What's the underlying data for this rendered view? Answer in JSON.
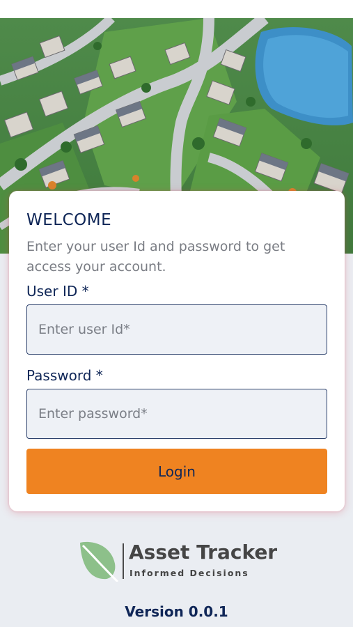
{
  "login_card": {
    "title": "WELCOME",
    "subtitle": "Enter your user Id and password to get access your account.",
    "user_id": {
      "label": "User ID *",
      "placeholder": "Enter user Id*",
      "value": ""
    },
    "password": {
      "label": "Password *",
      "placeholder": "Enter password*",
      "value": ""
    },
    "login_button": "Login"
  },
  "branding": {
    "logo_icon": "leaf-icon",
    "app_name": "Asset Tracker",
    "tagline": "Informed Decisions",
    "version": "Version 0.0.1"
  },
  "colors": {
    "primary_text": "#0f2657",
    "button": "#ef8321",
    "leaf": "#7fb77e"
  }
}
